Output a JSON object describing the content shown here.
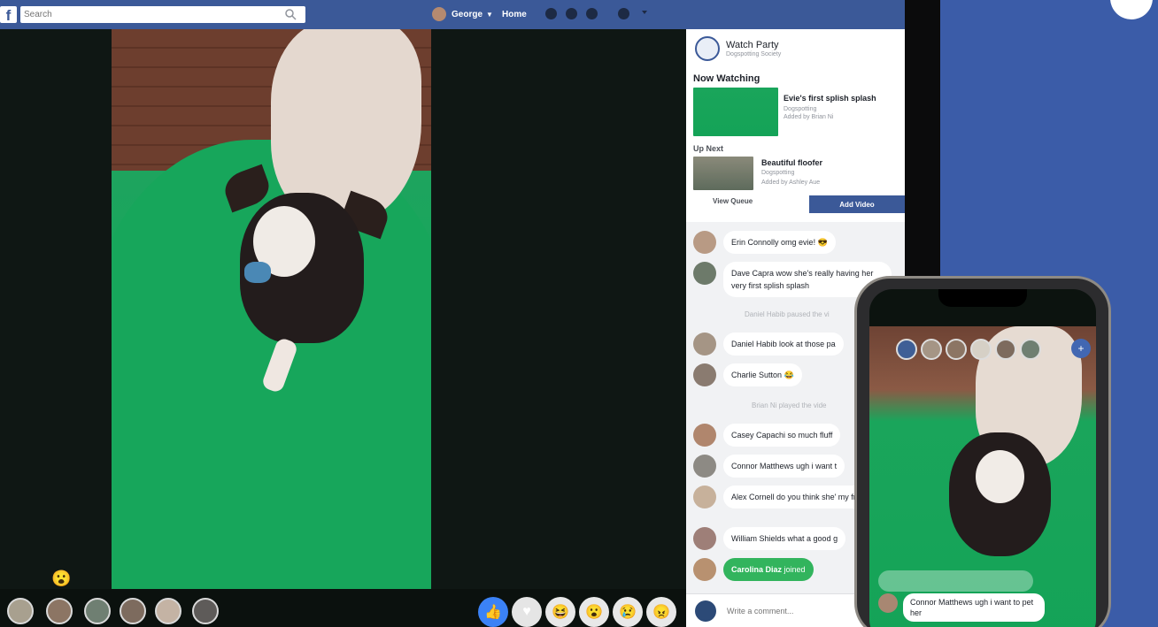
{
  "topbar": {
    "search_placeholder": "Search",
    "user_name": "George",
    "home_label": "Home"
  },
  "watch_party": {
    "title": "Watch Party",
    "group": "Dogspotting Society",
    "now_watching_label": "Now Watching",
    "now_watching": {
      "title": "Evie's first splish splash",
      "source": "Dogspotting",
      "added_by": "Added by Brian Ni"
    },
    "up_next_label": "Up Next",
    "up_next": {
      "title": "Beautiful floofer",
      "source": "Dogspotting",
      "added_by": "Added by Ashley Aue"
    },
    "view_queue_label": "View Queue",
    "add_video_label": "Add Video"
  },
  "chat": {
    "messages": [
      {
        "name": "Erin Connolly",
        "text": "omg evie! 😎"
      },
      {
        "name": "Dave Capra",
        "text": "wow she's really having her very first splish splash"
      },
      {
        "name": "Daniel Habib",
        "text": "look at those pa"
      },
      {
        "name": "Charlie Sutton",
        "text": "😂"
      },
      {
        "name": "Casey Capachi",
        "text": "so much fluff"
      },
      {
        "name": "Connor Matthews",
        "text": "ugh i want t"
      },
      {
        "name": "Alex Cornell",
        "text": "do you think she' my friend?"
      },
      {
        "name": "William Shields",
        "text": "what a good g"
      }
    ],
    "system": [
      {
        "text": "Daniel Habib paused the vi"
      },
      {
        "text": "Brian Ni played the vide"
      }
    ],
    "joined": {
      "name": "Carolina Diaz",
      "text": "joined"
    },
    "composer_placeholder": "Write a comment..."
  },
  "reactions": [
    "like",
    "love",
    "haha",
    "wow",
    "sad",
    "angry"
  ],
  "phone": {
    "message": {
      "name": "Connor Matthews",
      "text": "ugh i want to pet her"
    }
  },
  "colors": {
    "brand_blue": "#3b5998",
    "joined_green": "#32b45d",
    "background_blue": "#3b5ca8"
  }
}
